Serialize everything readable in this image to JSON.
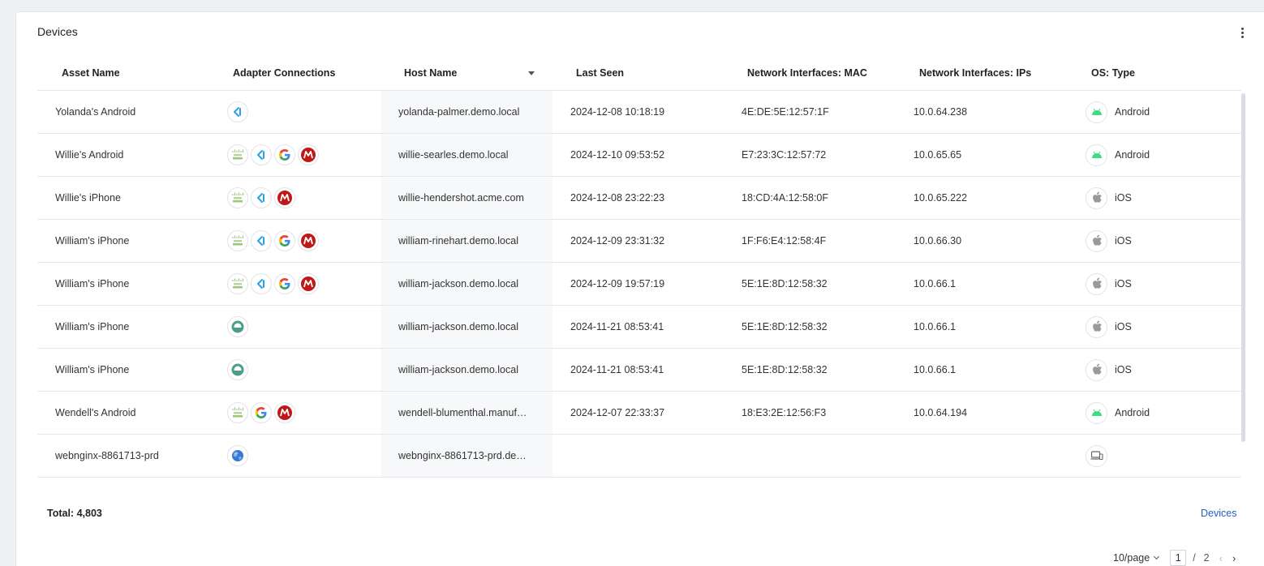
{
  "panel": {
    "title": "Devices",
    "menu_icon": "more-vertical-icon"
  },
  "table": {
    "columns": [
      {
        "key": "asset_name",
        "label": "Asset Name"
      },
      {
        "key": "adapters",
        "label": "Adapter Connections"
      },
      {
        "key": "host_name",
        "label": "Host Name",
        "sorted": "desc"
      },
      {
        "key": "last_seen",
        "label": "Last Seen"
      },
      {
        "key": "mac",
        "label": "Network Interfaces: MAC"
      },
      {
        "key": "ips",
        "label": "Network Interfaces: IPs"
      },
      {
        "key": "os",
        "label": "OS: Type"
      }
    ],
    "rows": [
      {
        "asset_name": "Yolanda's Android",
        "adapters": [
          "intune"
        ],
        "host_name": "yolanda-palmer.demo.local",
        "last_seen": "2024-12-08 10:18:19",
        "mac": "4E:DE:5E:12:57:1F",
        "ips": "10.0.64.238",
        "os_icon": "android",
        "os": "Android"
      },
      {
        "asset_name": "Willie's Android",
        "adapters": [
          "cisco-meraki",
          "intune",
          "google",
          "mcafee"
        ],
        "host_name": "willie-searles.demo.local",
        "last_seen": "2024-12-10 09:53:52",
        "mac": "E7:23:3C:12:57:72",
        "ips": "10.0.65.65",
        "os_icon": "android",
        "os": "Android"
      },
      {
        "asset_name": "Willie's iPhone",
        "adapters": [
          "cisco-meraki",
          "intune",
          "mcafee"
        ],
        "host_name": "willie-hendershot.acme.com",
        "last_seen": "2024-12-08 23:22:23",
        "mac": "18:CD:4A:12:58:0F",
        "ips": "10.0.65.222",
        "os_icon": "apple",
        "os": "iOS"
      },
      {
        "asset_name": "William's iPhone",
        "adapters": [
          "cisco-meraki",
          "intune",
          "google",
          "mcafee"
        ],
        "host_name": "william-rinehart.demo.local",
        "last_seen": "2024-12-09 23:31:32",
        "mac": "1F:F6:E4:12:58:4F",
        "ips": "10.0.66.30",
        "os_icon": "apple",
        "os": "iOS"
      },
      {
        "asset_name": "William's iPhone",
        "adapters": [
          "cisco-meraki",
          "intune",
          "google",
          "mcafee"
        ],
        "host_name": "william-jackson.demo.local",
        "last_seen": "2024-12-09 19:57:19",
        "mac": "5E:1E:8D:12:58:32",
        "ips": "10.0.66.1",
        "os_icon": "apple",
        "os": "iOS"
      },
      {
        "asset_name": "William's iPhone",
        "adapters": [
          "ring"
        ],
        "host_name": "william-jackson.demo.local",
        "last_seen": "2024-11-21 08:53:41",
        "mac": "5E:1E:8D:12:58:32",
        "ips": "10.0.66.1",
        "os_icon": "apple",
        "os": "iOS"
      },
      {
        "asset_name": "William's iPhone",
        "adapters": [
          "ring"
        ],
        "host_name": "william-jackson.demo.local",
        "last_seen": "2024-11-21 08:53:41",
        "mac": "5E:1E:8D:12:58:32",
        "ips": "10.0.66.1",
        "os_icon": "apple",
        "os": "iOS"
      },
      {
        "asset_name": "Wendell's Android",
        "adapters": [
          "cisco-meraki",
          "google",
          "mcafee"
        ],
        "host_name": "wendell-blumenthal.manuf…",
        "last_seen": "2024-12-07 22:33:37",
        "mac": "18:E3:2E:12:56:F3",
        "ips": "10.0.64.194",
        "os_icon": "android",
        "os": "Android"
      },
      {
        "asset_name": "webnginx-8861713-prd",
        "adapters": [
          "globe"
        ],
        "host_name": "webnginx-8861713-prd.de…",
        "last_seen": "",
        "mac": "",
        "ips": "",
        "os_icon": "devices",
        "os": ""
      }
    ]
  },
  "footer": {
    "total_label": "Total: 4,803",
    "link_label": "Devices"
  },
  "pagination": {
    "page_size": "10/page",
    "current_page": "1",
    "separator": "/",
    "total_pages": "2",
    "prev_icon": "‹",
    "next_icon": "›"
  }
}
